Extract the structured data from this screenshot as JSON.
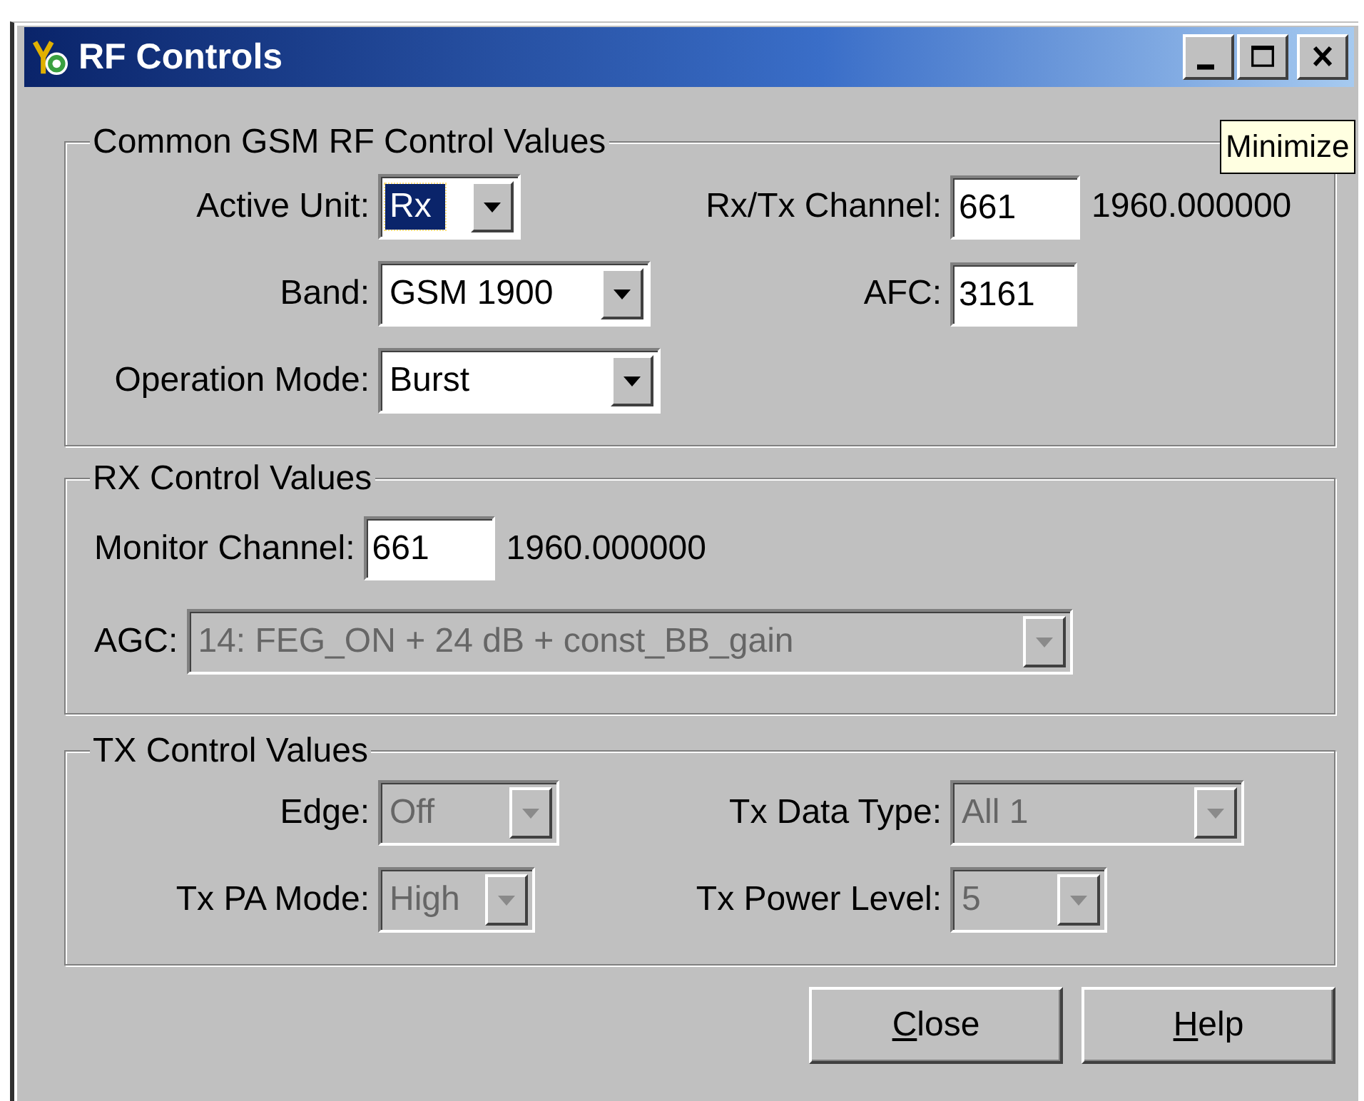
{
  "window": {
    "title": "RF Controls"
  },
  "tooltip": "Minimize",
  "groups": [
    {
      "title": "Common GSM RF Control Values",
      "rows": [
        [
          {
            "label": "Active Unit:",
            "kind": "combo",
            "value": "Rx",
            "focused": true,
            "disabled": false
          },
          {
            "label": "Rx/Tx Channel:",
            "kind": "edit",
            "value": "661",
            "suffix": "1960.000000",
            "focused": false,
            "disabled": false
          }
        ],
        [
          {
            "label": "Band:",
            "kind": "combo",
            "value": "GSM 1900",
            "focused": false,
            "disabled": false
          },
          {
            "label": "AFC:",
            "kind": "edit",
            "value": "3161",
            "focused": false,
            "disabled": false
          }
        ],
        [
          {
            "label": "Operation Mode:",
            "kind": "combo",
            "value": "Burst",
            "focused": false,
            "disabled": false
          }
        ]
      ]
    },
    {
      "title": "RX Control Values",
      "rows": [
        [
          {
            "label": "Monitor Channel:",
            "kind": "edit",
            "value": "661",
            "suffix": "1960.000000",
            "focused": false,
            "disabled": false
          }
        ],
        [
          {
            "label": "AGC:",
            "kind": "combo",
            "value": "14: FEG_ON + 24 dB + const_BB_gain",
            "focused": false,
            "disabled": true
          }
        ]
      ]
    },
    {
      "title": "TX Control Values",
      "rows": [
        [
          {
            "label": "Edge:",
            "kind": "combo",
            "value": "Off",
            "focused": false,
            "disabled": true
          },
          {
            "label": "Tx Data Type:",
            "kind": "combo",
            "value": "All 1",
            "focused": false,
            "disabled": true
          }
        ],
        [
          {
            "label": "Tx PA Mode:",
            "kind": "combo",
            "value": "High",
            "focused": false,
            "disabled": true
          },
          {
            "label": "Tx Power Level:",
            "kind": "combo",
            "value": "5",
            "focused": false,
            "disabled": true
          }
        ]
      ]
    }
  ],
  "buttons": [
    {
      "label": "Close",
      "mnemonic": true
    },
    {
      "label": "Help",
      "mnemonic": true
    }
  ]
}
